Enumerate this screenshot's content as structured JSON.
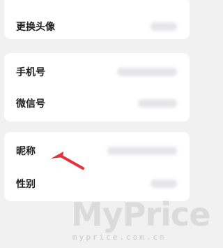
{
  "settings": {
    "groups": [
      {
        "rows": [
          {
            "label": "更换头像"
          }
        ]
      },
      {
        "rows": [
          {
            "label": "手机号"
          },
          {
            "label": "微信号"
          }
        ]
      },
      {
        "rows": [
          {
            "label": "昵称"
          },
          {
            "label": "性别"
          }
        ]
      }
    ]
  },
  "annotation": {
    "arrow_color": "#e8303a"
  },
  "watermark": {
    "main": "MyPrice",
    "sub": "myprice.com.cn"
  }
}
